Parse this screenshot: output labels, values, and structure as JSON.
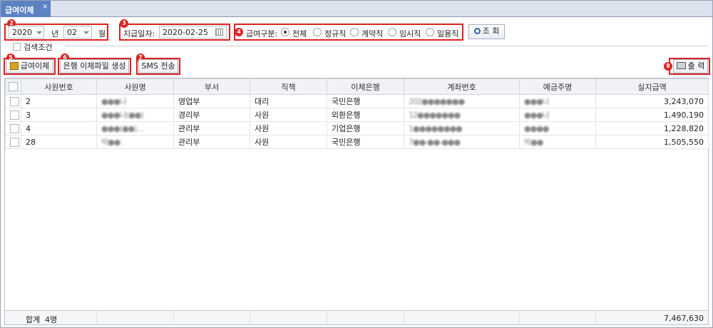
{
  "tab": {
    "title": "급여이체",
    "close": "×"
  },
  "filters": {
    "year": "2020",
    "year_unit": "년",
    "month": "02",
    "month_unit": "월",
    "pay_date_label": "지급일자:",
    "pay_date": "2020-02-25",
    "pay_type_label": "급여구분:",
    "pay_types": [
      "전체",
      "정규직",
      "계약직",
      "임시직",
      "일용직"
    ],
    "pay_type_selected": "전체",
    "search_button": "조 회"
  },
  "search_condition": "검색조건",
  "actions": {
    "transfer": "급여이체",
    "bank_file": "은행 이체파일 생성",
    "sms": "SMS 전송",
    "print": "출 력"
  },
  "badges": [
    "2",
    "3",
    "4",
    "5",
    "6",
    "7",
    "8"
  ],
  "table": {
    "columns": [
      "사원번호",
      "사원명",
      "부서",
      "직책",
      "이체은행",
      "계좌번호",
      "예금주명",
      "실지급액"
    ],
    "rows": [
      {
        "emp_no": "2",
        "name": "●●●나",
        "dept": "영업부",
        "position": "대리",
        "bank": "국민은행",
        "account": "202●●●●●●●",
        "holder": "●●●나",
        "amount": "3,243,070"
      },
      {
        "emp_no": "3",
        "name": "●●●나(●●)",
        "dept": "경리부",
        "position": "사원",
        "bank": "외환은행",
        "account": "12●●●●●●●",
        "holder": "●●●나",
        "amount": "1,490,190"
      },
      {
        "emp_no": "4",
        "name": "●●●(●●)…",
        "dept": "관리부",
        "position": "사원",
        "bank": "기업은행",
        "account": "1●●●●●●●●",
        "holder": "●●●●",
        "amount": "1,228,820"
      },
      {
        "emp_no": "28",
        "name": "박●●",
        "dept": "관리부",
        "position": "사원",
        "bank": "국민은행",
        "account": "7●●-●●-●●●",
        "holder": "박●●",
        "amount": "1,505,550"
      }
    ],
    "footer_label": "합계",
    "footer_count": "4명",
    "footer_total": "7,467,630"
  }
}
